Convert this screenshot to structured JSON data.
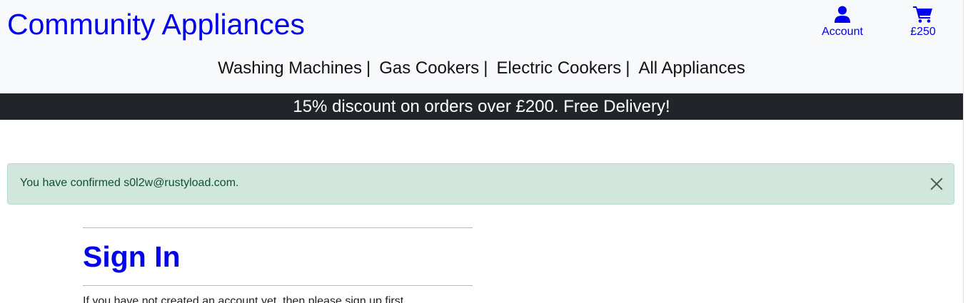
{
  "header": {
    "brand": "Community Appliances",
    "account_label": "Account",
    "cart_label": "£250",
    "account_icon": "user-icon",
    "cart_icon": "shopping-cart-icon"
  },
  "nav": {
    "items": [
      {
        "label": "Washing Machines",
        "sep": "|"
      },
      {
        "label": "Gas Cookers",
        "sep": "|"
      },
      {
        "label": "Electric Cookers",
        "sep": "|"
      },
      {
        "label": "All Appliances",
        "sep": ""
      }
    ]
  },
  "banner": {
    "text": "15% discount on orders over £200. Free Delivery!"
  },
  "alert": {
    "message": "You have confirmed s0l2w@rustyload.com.",
    "close_icon": "close-icon"
  },
  "signin": {
    "title": "Sign In",
    "intro": "If you have not created an account yet, then please sign up first."
  },
  "colors": {
    "brand": "#0000ee",
    "banner_bg": "#212529",
    "alert_bg": "#d1e7dd",
    "alert_text": "#0f5132",
    "header_bg": "#f8f9fa"
  }
}
